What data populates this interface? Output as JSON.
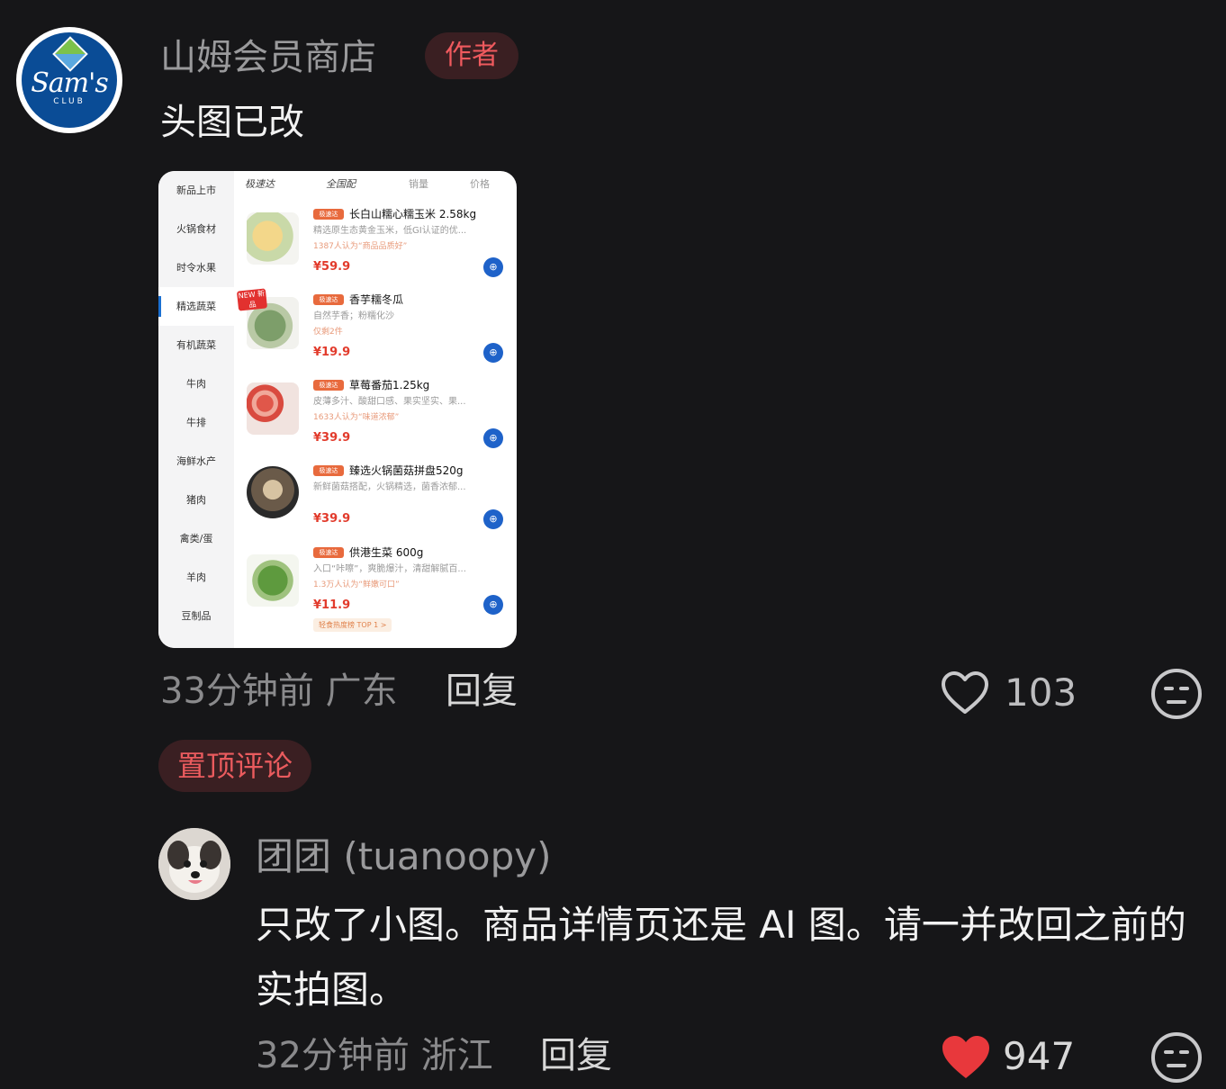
{
  "comments": [
    {
      "username": "山姆会员商店",
      "badge": "作者",
      "text": "头图已改",
      "time": "33分钟前",
      "location": "广东",
      "reply_label": "回复",
      "likes": "103",
      "liked": false,
      "avatar_logo": {
        "word": "Sam's",
        "club": "CLUB"
      },
      "image": {
        "sidebar": [
          "新品上市",
          "火锅食材",
          "时令水果",
          "精选蔬菜",
          "有机蔬菜",
          "牛肉",
          "牛排",
          "海鲜水产",
          "猪肉",
          "禽类/蛋",
          "羊肉",
          "豆制品"
        ],
        "active_sidebar_index": 3,
        "tabs": [
          "极速达",
          "全国配",
          "销量",
          "价格"
        ],
        "products": [
          {
            "tag": "极速达",
            "title": "长白山糯心糯玉米 2.58kg",
            "desc": "精选原生态黄金玉米，低GI认证的优...",
            "note": "1387人认为“商品品质好”",
            "price": "¥59.9"
          },
          {
            "tag": "极速达",
            "title": "香芋糯冬瓜",
            "desc": "自然芋香；粉糯化沙",
            "note": "仅剩2件",
            "price": "¥19.9"
          },
          {
            "tag": "极速达",
            "title": "草莓番茄1.25kg",
            "desc": "皮薄多汁、酸甜口感、果实坚实、果...",
            "note": "1633人认为“味道浓郁”",
            "price": "¥39.9"
          },
          {
            "tag": "极速达",
            "title": "臻选火锅菌菇拼盘520g",
            "desc": "新鲜菌菇搭配，火锅精选，菌香浓郁...",
            "note": "",
            "price": "¥39.9"
          },
          {
            "tag": "极速达",
            "title": "供港生菜 600g",
            "desc": "入口“咔嚓”，爽脆爆汁，清甜解腻百...",
            "note": "1.3万人认为“鲜嫩可口”",
            "price": "¥11.9"
          }
        ],
        "new_tag": "NEW 新品",
        "rank_tag": "轻食热度榜 TOP 1 >"
      }
    },
    {
      "pinned_label": "置顶评论",
      "username": "团团 (tuanoopy)",
      "text": "只改了小图。商品详情页还是 AI 图。请一并改回之前的实拍图。",
      "time": "32分钟前",
      "location": "浙江",
      "reply_label": "回复",
      "likes": "947",
      "liked": true
    }
  ],
  "colors": {
    "background": "#161618",
    "badge_red": "#f05a5e",
    "liked_heart": "#e8383c"
  },
  "icons": [
    "heart-outline-icon",
    "heart-filled-icon",
    "meh-face-icon",
    "cart-icon"
  ]
}
